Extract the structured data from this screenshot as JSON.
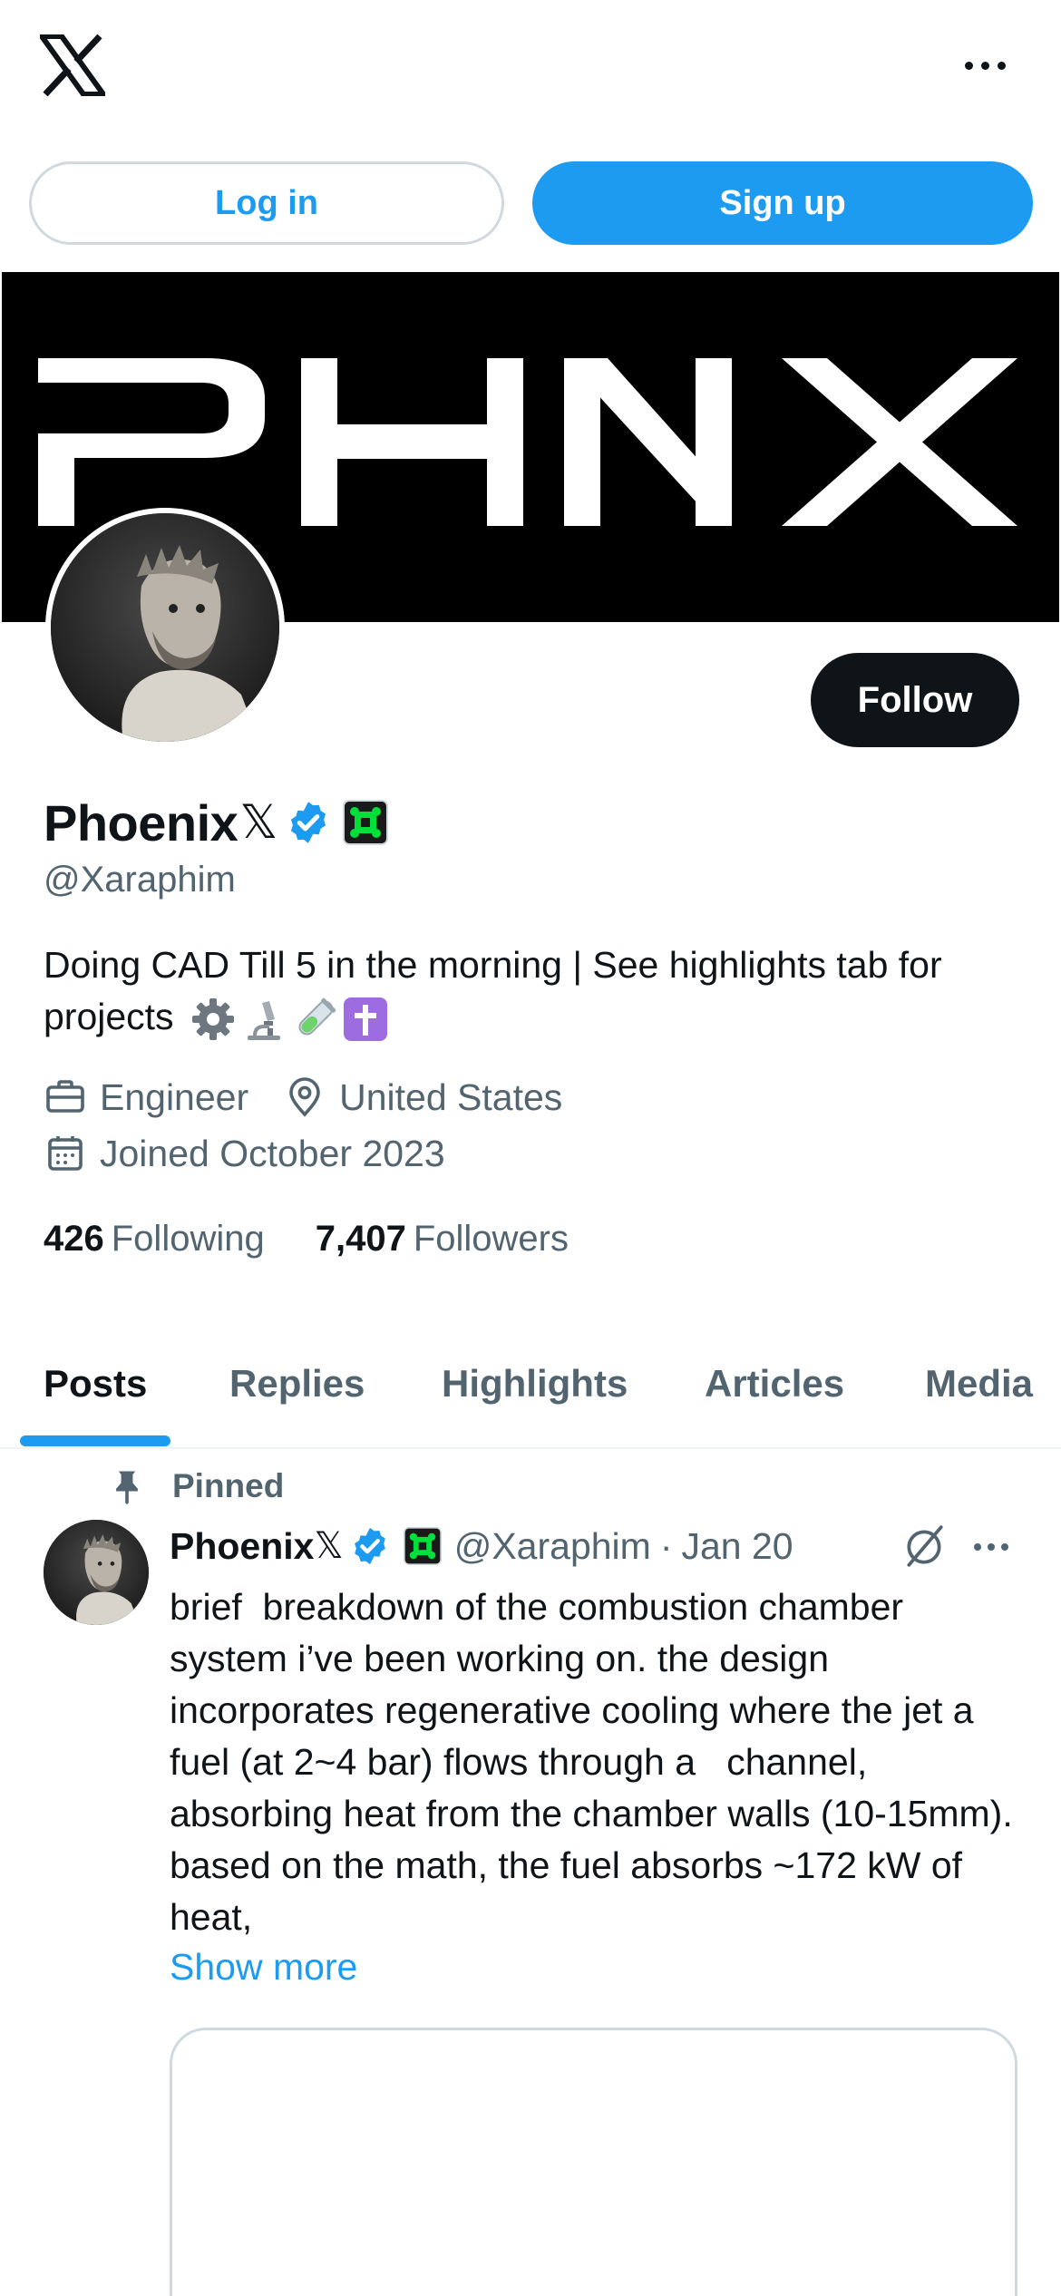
{
  "topbar": {
    "logo_icon": "x-logo-icon",
    "more_icon": "more-horizontal-icon",
    "login_label": "Log in",
    "signup_label": "Sign up"
  },
  "banner": {
    "text": "PHNX",
    "background": "#000000",
    "text_color": "#ffffff"
  },
  "profile": {
    "display_name": "Phoenix",
    "name_glyph": "𝕏",
    "verified_icon": "verified-badge-icon",
    "affiliate_icon": "affiliate-badge-icon",
    "handle": "@Xaraphim",
    "follow_label": "Follow",
    "bio": "Doing CAD Till 5 in the morning | See highlights tab for projects",
    "bio_emojis": [
      "gear-icon",
      "microscope-icon",
      "test-tube-icon",
      "latin-cross-icon"
    ],
    "profession": "Engineer",
    "location": "United States",
    "joined": "Joined October 2023",
    "following_count": "426",
    "following_label": "Following",
    "followers_count": "7,407",
    "followers_label": "Followers"
  },
  "tabs": [
    {
      "label": "Posts",
      "active": true
    },
    {
      "label": "Replies",
      "active": false
    },
    {
      "label": "Highlights",
      "active": false
    },
    {
      "label": "Articles",
      "active": false
    },
    {
      "label": "Media",
      "active": false
    }
  ],
  "post": {
    "pinned_label": "Pinned",
    "author_name": "Phoenix",
    "author_glyph": "𝕏",
    "author_handle": "@Xaraphim",
    "separator": "·",
    "date": "Jan 20",
    "text": "brief  breakdown of the combustion chamber system i’ve been working on. the design incorporates regenerative cooling where the jet a fuel (at 2~4 bar) flows through a   channel, absorbing heat from the chamber walls (10-15mm). based on the math, the fuel absorbs ~172 kW of heat,",
    "show_more": "Show more"
  },
  "colors": {
    "accent": "#1d9bf0",
    "text_primary": "#0f1419",
    "text_secondary": "#536471",
    "border": "#cfd9de",
    "affiliate_green": "#00e03a"
  }
}
